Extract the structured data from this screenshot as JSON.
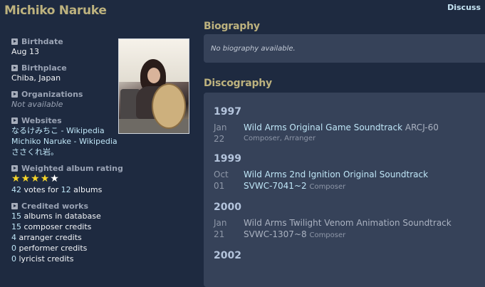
{
  "page_title": "Michiko Naruke",
  "discuss_label": "Discuss",
  "sidebar": {
    "birthdate": {
      "label": "Birthdate",
      "value": "Aug 13"
    },
    "birthplace": {
      "label": "Birthplace",
      "value": "Chiba, Japan"
    },
    "organizations": {
      "label": "Organizations",
      "value": "Not available"
    },
    "websites": {
      "label": "Websites",
      "links": [
        "なるけみちこ - Wikipedia",
        "Michiko Naruke - Wikipedia",
        "ささくれ岩。"
      ]
    },
    "rating": {
      "label": "Weighted album rating",
      "stars_filled": 4,
      "stars_total": 5,
      "votes": "42",
      "votes_text": " votes for ",
      "albums": "12",
      "albums_text": " albums"
    },
    "credited_works": {
      "label": "Credited works",
      "lines": [
        {
          "count": "15",
          "text": " albums in database"
        },
        {
          "count": "15",
          "text": " composer credits"
        },
        {
          "count": "4",
          "text": " arranger credits"
        },
        {
          "count": "0",
          "text": " performer credits"
        },
        {
          "count": "0",
          "text": " lyricist credits"
        }
      ]
    }
  },
  "biography": {
    "title": "Biography",
    "text": "No biography available."
  },
  "discography": {
    "title": "Discography",
    "years": [
      {
        "year": "1997",
        "month": "Jan",
        "day": "22",
        "album": "Wild Arms Original Game Soundtrack",
        "catalog": "ARCJ-60",
        "credit": "Composer, Arranger",
        "catalog_link": false
      },
      {
        "year": "1999",
        "month": "Oct",
        "day": "01",
        "album": "Wild Arms 2nd Ignition Original Soundtrack",
        "catalog": "SVWC-7041~2",
        "credit": "Composer",
        "catalog_link": true
      },
      {
        "year": "2000",
        "month": "Jan",
        "day": "21",
        "album": "Wild Arms Twilight Venom Animation Soundtrack",
        "catalog": "SVWC-1307~8",
        "credit": "Composer",
        "catalog_link": false
      },
      {
        "year": "2002"
      }
    ]
  },
  "colors": {
    "title": "#bdb27e",
    "background": "#1e2a40",
    "panel": "#364259",
    "link": "#bfe6f7",
    "star": "#f5d52a"
  }
}
